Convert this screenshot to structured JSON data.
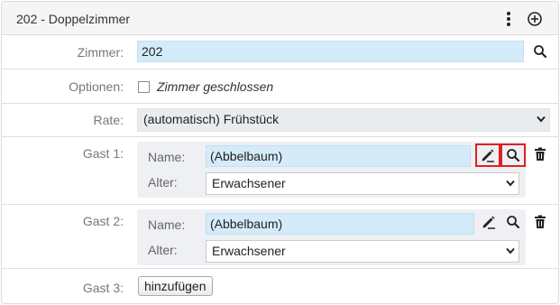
{
  "header": {
    "title": "202 - Doppelzimmer"
  },
  "room": {
    "label": "Zimmer:",
    "value": "202"
  },
  "options": {
    "label": "Optionen:",
    "closed_label": "Zimmer geschlossen",
    "closed_checked": false
  },
  "rate": {
    "label": "Rate:",
    "value": "(automatisch) Frühstück"
  },
  "guests": [
    {
      "label": "Gast 1:",
      "name_label": "Name:",
      "name_value": "(Abbelbaum)",
      "age_label": "Alter:",
      "age_value": "Erwachsener"
    },
    {
      "label": "Gast 2:",
      "name_label": "Name:",
      "name_value": "(Abbelbaum)",
      "age_label": "Alter:",
      "age_value": "Erwachsener"
    }
  ],
  "guest3": {
    "label": "Gast 3:",
    "add_label": "hinzufügen"
  },
  "colors": {
    "field_blue": "#d4ebf9",
    "highlight_red": "#e02020",
    "guest_box_bg": "#eef0f3"
  }
}
